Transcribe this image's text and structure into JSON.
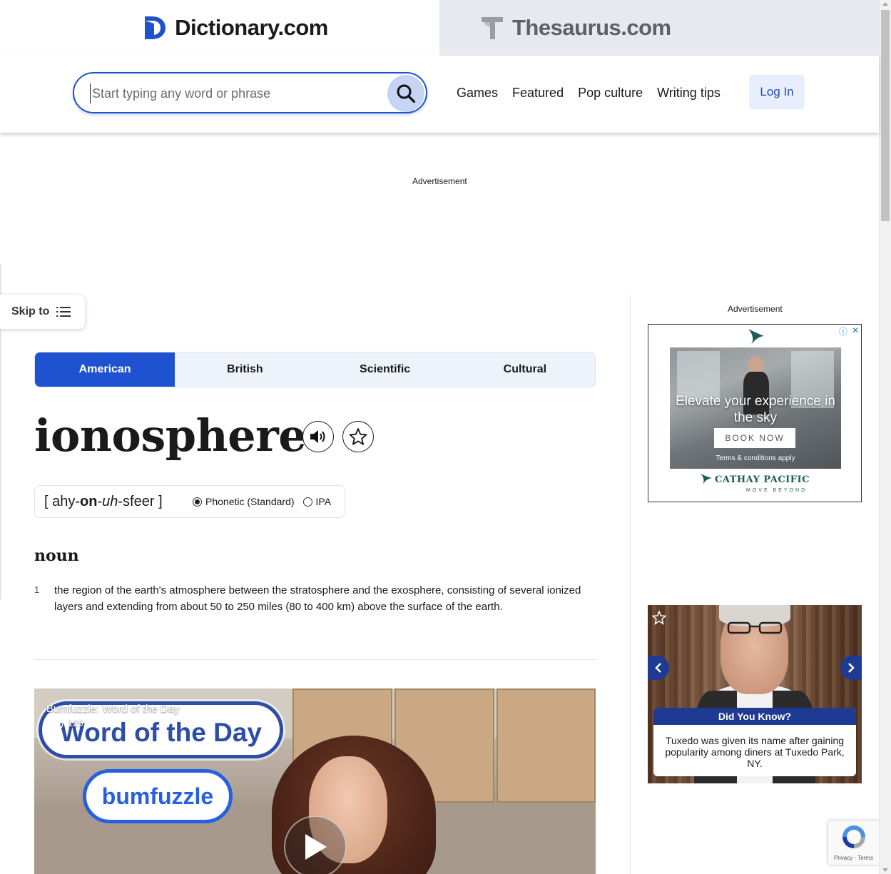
{
  "brand": {
    "dictionary_name": "Dictionary.com",
    "thesaurus_name": "Thesaurus.com"
  },
  "search": {
    "placeholder": "Start typing any word or phrase",
    "value": ""
  },
  "nav": {
    "items": [
      "Games",
      "Featured",
      "Pop culture",
      "Writing tips"
    ],
    "login_label": "Log In"
  },
  "ads": {
    "label": "Advertisement",
    "cathay": {
      "headline": "Elevate your experience in the sky",
      "cta": "BOOK NOW",
      "terms": "Terms & conditions apply",
      "brand": "CATHAY PACIFIC",
      "tagline": "MOVE BEYOND"
    },
    "did_you_know": {
      "title": "Did You Know?",
      "body": "Tuxedo was given its name after gaining popularity among diners at Tuxedo Park, NY."
    }
  },
  "skip_to": {
    "label": "Skip to"
  },
  "dialect_tabs": {
    "items": [
      "American",
      "British",
      "Scientific",
      "Cultural"
    ],
    "active": "American"
  },
  "entry": {
    "headword": "ionosphere",
    "pronunciation": {
      "open": "[ ",
      "p1": "ahy-",
      "p2": "on",
      "p3": "-",
      "p4": "uh",
      "p5": "-sfeer",
      "close": " ]"
    },
    "pron_options": {
      "phonetic": "Phonetic (Standard)",
      "ipa": "IPA",
      "selected": "Phonetic (Standard)"
    },
    "part_of_speech": "noun",
    "definitions": [
      {
        "number": "1",
        "text": "the region of the earth's atmosphere between the stratosphere and the exosphere, consisting of several ionized layers and extending from about 50 to 250 miles (80 to 400 km) above the surface of the earth."
      }
    ]
  },
  "video": {
    "title": "Bumfuzzle: Word of the Day",
    "likes": "125",
    "banner": "Word of the Day",
    "word": "bumfuzzle"
  },
  "recaptcha": {
    "links": "Privacy - Terms"
  },
  "colors": {
    "brand_blue": "#1f52d1",
    "thesaurus_tab_bg": "#e8e9ee",
    "did_you_know_blue": "#1e3a93",
    "cathay_green": "#1d5c5a"
  },
  "icons": {
    "search": "search-icon",
    "audio": "speaker-icon",
    "favorite": "star-icon",
    "skip_list": "list-icon",
    "play": "play-icon",
    "like": "thumbs-up-icon"
  }
}
